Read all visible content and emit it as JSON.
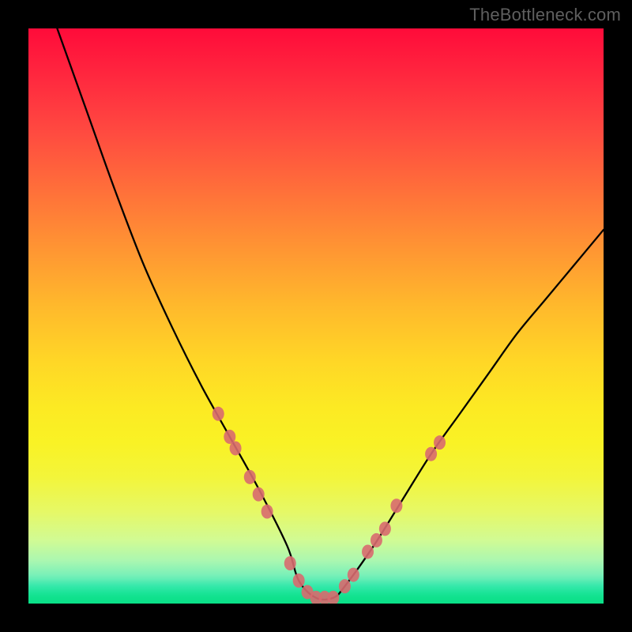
{
  "watermark": "TheBottleneck.com",
  "chart_data": {
    "type": "line",
    "title": "",
    "xlabel": "",
    "ylabel": "",
    "xlim": [
      0,
      100
    ],
    "ylim": [
      0,
      100
    ],
    "grid": false,
    "legend": false,
    "series": [
      {
        "name": "bottleneck-curve",
        "stroke": "#000000",
        "x": [
          5,
          10,
          15,
          20,
          25,
          30,
          35,
          40,
          45,
          47,
          50,
          53,
          55,
          60,
          65,
          70,
          75,
          80,
          85,
          90,
          95,
          100
        ],
        "values": [
          100,
          86,
          72,
          59,
          48,
          38,
          29,
          20,
          10,
          4,
          1,
          1,
          3,
          10,
          18,
          26,
          33,
          40,
          47,
          53,
          59,
          65
        ]
      }
    ],
    "markers": {
      "name": "highlight-points",
      "color": "#d86a6f",
      "points_xy": [
        [
          33,
          33
        ],
        [
          35,
          29
        ],
        [
          36,
          27
        ],
        [
          38.5,
          22
        ],
        [
          40,
          19
        ],
        [
          41.5,
          16
        ],
        [
          45.5,
          7
        ],
        [
          47,
          4
        ],
        [
          48.5,
          2
        ],
        [
          50,
          1
        ],
        [
          51.5,
          1
        ],
        [
          53,
          1
        ],
        [
          55,
          3
        ],
        [
          56.5,
          5
        ],
        [
          59,
          9
        ],
        [
          60.5,
          11
        ],
        [
          62,
          13
        ],
        [
          64,
          17
        ],
        [
          70,
          26
        ],
        [
          71.5,
          28
        ]
      ]
    },
    "background_gradient": {
      "orientation": "vertical",
      "stops": [
        {
          "pos": 0.0,
          "color": "#ff0b3a"
        },
        {
          "pos": 0.5,
          "color": "#ffcf29"
        },
        {
          "pos": 0.8,
          "color": "#eef942"
        },
        {
          "pos": 1.0,
          "color": "#0be58c"
        }
      ]
    }
  }
}
